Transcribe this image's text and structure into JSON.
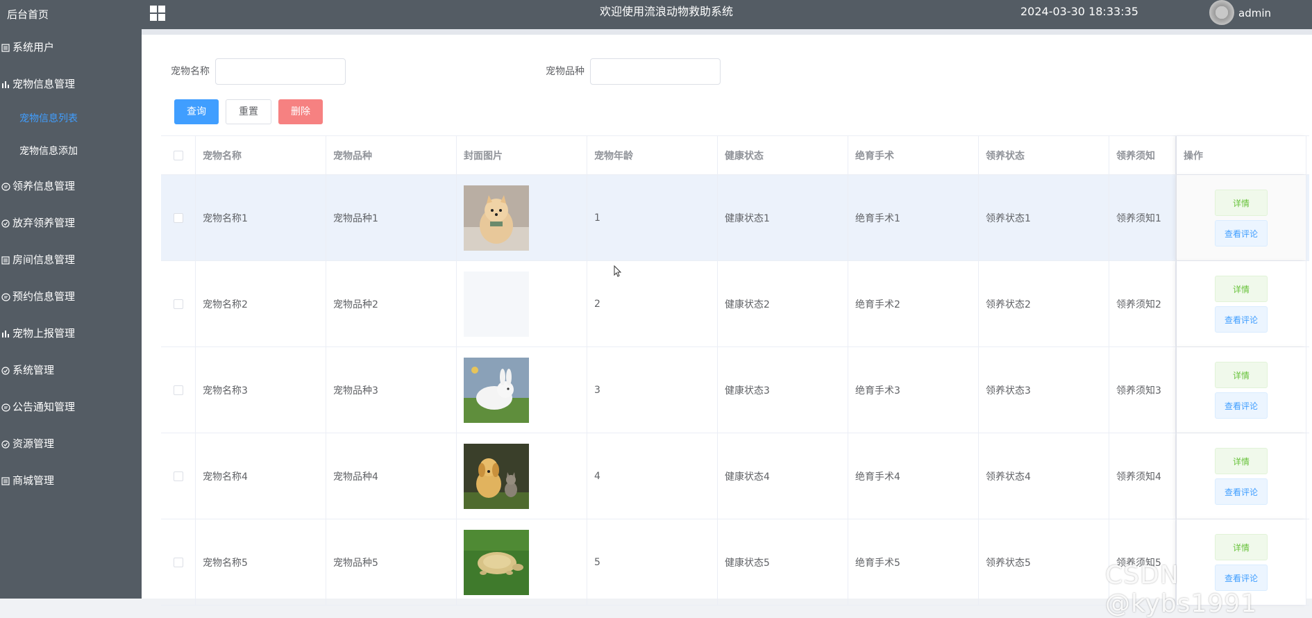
{
  "sidebar": {
    "home": "后台首页",
    "items": [
      {
        "label": "系统用户",
        "icon": "list-icon"
      },
      {
        "label": "宠物信息管理",
        "icon": "chart-icon"
      },
      {
        "label": "领养信息管理",
        "icon": "chat-icon"
      },
      {
        "label": "放弃领养管理",
        "icon": "check-circle-icon"
      },
      {
        "label": "房间信息管理",
        "icon": "list-icon"
      },
      {
        "label": "预约信息管理",
        "icon": "chat-icon"
      },
      {
        "label": "宠物上报管理",
        "icon": "chart-icon"
      },
      {
        "label": "系统管理",
        "icon": "check-circle-icon"
      },
      {
        "label": "公告通知管理",
        "icon": "chat-icon"
      },
      {
        "label": "资源管理",
        "icon": "check-circle-icon"
      },
      {
        "label": "商城管理",
        "icon": "list-icon"
      }
    ],
    "sub_items": [
      {
        "label": "宠物信息列表",
        "active": true
      },
      {
        "label": "宠物信息添加",
        "active": false
      }
    ]
  },
  "header": {
    "title": "欢迎使用流浪动物救助系统",
    "datetime": "2024-03-30 18:33:35",
    "username": "admin"
  },
  "search": {
    "name_label": "宠物名称",
    "name_value": "",
    "breed_label": "宠物品种",
    "breed_value": "",
    "query_btn": "查询",
    "reset_btn": "重置",
    "delete_btn": "删除"
  },
  "table": {
    "columns": [
      "宠物名称",
      "宠物品种",
      "封面图片",
      "宠物年龄",
      "健康状态",
      "绝育手术",
      "领养状态",
      "领养须知",
      "操作"
    ],
    "rows": [
      {
        "name": "宠物名称1",
        "breed": "宠物品种1",
        "image": "pomeranian",
        "age": "1",
        "health": "健康状态1",
        "neuter": "绝育手术1",
        "adopt": "领养状态1",
        "notice": "领养须知1"
      },
      {
        "name": "宠物名称2",
        "breed": "宠物品种2",
        "image": "blank",
        "age": "2",
        "health": "健康状态2",
        "neuter": "绝育手术2",
        "adopt": "领养状态2",
        "notice": "领养须知2"
      },
      {
        "name": "宠物名称3",
        "breed": "宠物品种3",
        "image": "rabbit",
        "age": "3",
        "health": "健康状态3",
        "neuter": "绝育手术3",
        "adopt": "领养状态3",
        "notice": "领养须知3"
      },
      {
        "name": "宠物名称4",
        "breed": "宠物品种4",
        "image": "puppy-kitten",
        "age": "4",
        "health": "健康状态4",
        "neuter": "绝育手术4",
        "adopt": "领养状态4",
        "notice": "领养须知4"
      },
      {
        "name": "宠物名称5",
        "breed": "宠物品种5",
        "image": "tortoise",
        "age": "5",
        "health": "健康状态5",
        "neuter": "绝育手术5",
        "adopt": "领养状态5",
        "notice": "领养须知5"
      }
    ],
    "detail_btn": "详情",
    "review_btn": "查看评论"
  },
  "watermark": "CSDN @kybs1991",
  "colors": {
    "sidebar_bg": "#545c64",
    "primary": "#409eff",
    "danger": "#f56c6c",
    "success": "#67c23a"
  }
}
